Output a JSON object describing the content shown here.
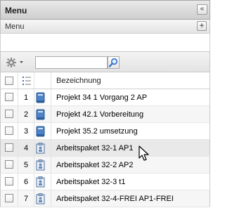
{
  "panel": {
    "title": "Menu",
    "collapse_icon": "double-chevron-left"
  },
  "subpanel": {
    "label": "Menu",
    "add_icon": "plus"
  },
  "toolbar": {
    "gear_icon": "gear-with-dropdown",
    "search_value": "",
    "search_icon": "magnifier"
  },
  "table": {
    "columns": [
      "",
      "",
      "",
      "Bezeichnung"
    ],
    "rows": [
      {
        "num": "1",
        "icon": "project-book",
        "label": "Projekt 34 1 Vorgang 2 AP"
      },
      {
        "num": "2",
        "icon": "project-book",
        "label": "Projekt 42.1 Vorbereitung"
      },
      {
        "num": "3",
        "icon": "project-book",
        "label": "Projekt 35.2 umsetzung"
      },
      {
        "num": "4",
        "icon": "work-package",
        "label": "Arbeitspaket 32-1 AP1"
      },
      {
        "num": "5",
        "icon": "work-package",
        "label": "Arbeitspaket 32-2 AP2"
      },
      {
        "num": "6",
        "icon": "work-package",
        "label": "Arbeitspaket 32-3 t1"
      },
      {
        "num": "7",
        "icon": "work-package",
        "label": "Arbeitspaket 32-4-FREI AP1-FREI"
      }
    ]
  },
  "colors": {
    "project_icon": "#3b6fb6",
    "work_package_icon": "#6d8bb5",
    "hover_row": "#e9e9e9"
  }
}
